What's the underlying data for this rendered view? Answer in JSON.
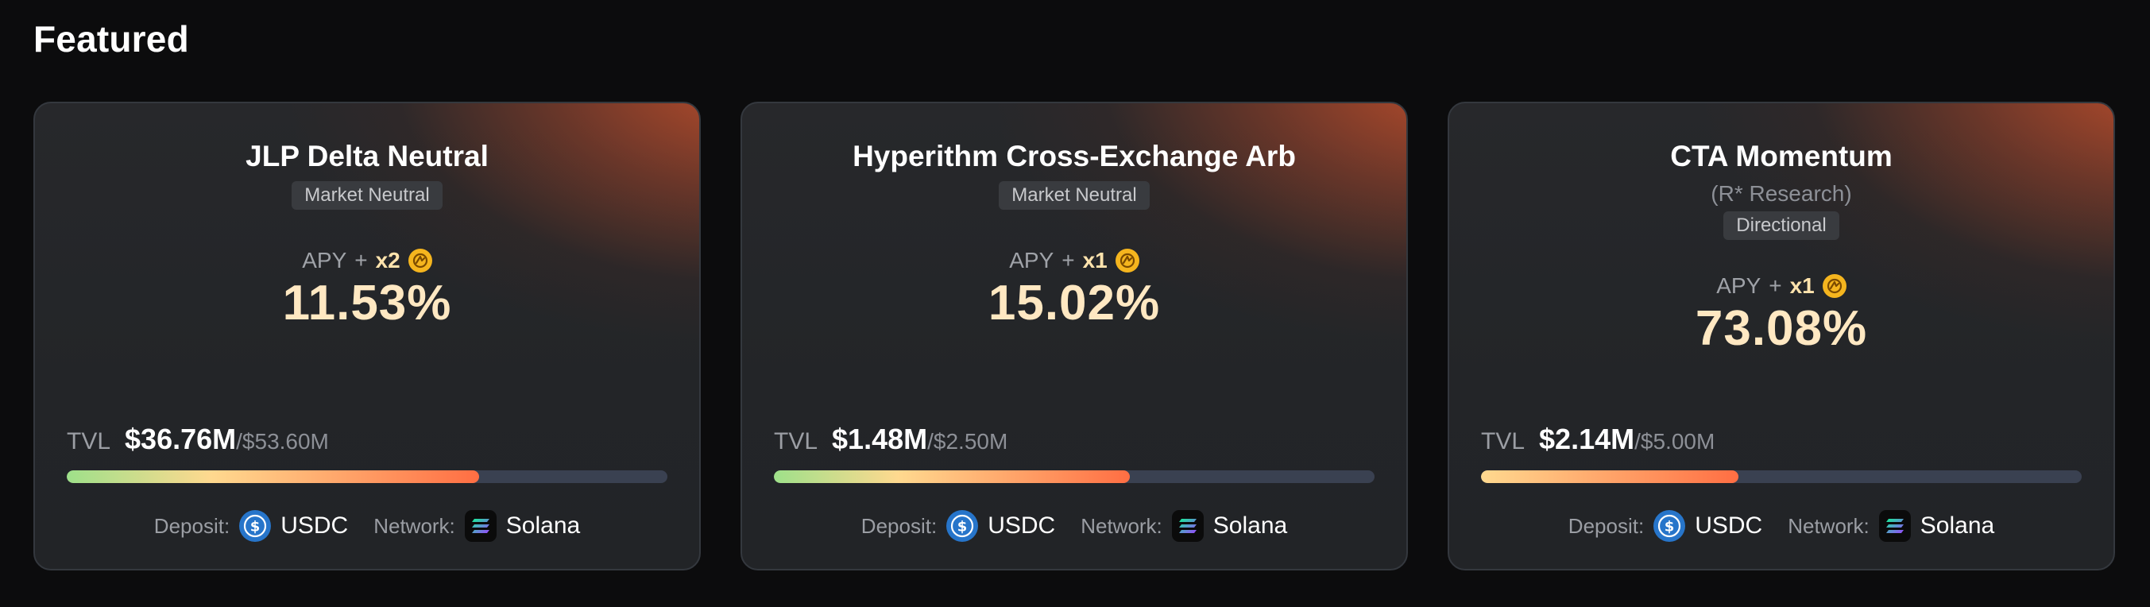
{
  "section": {
    "title": "Featured"
  },
  "labels": {
    "apy": "APY",
    "plus": "+",
    "tvl": "TVL",
    "deposit": "Deposit:",
    "network": "Network:"
  },
  "colors": {
    "background": "#0c0c0d",
    "card_glow": "#c6502c",
    "apy_value": "#ffe8c2",
    "progress_track": "#3a4151",
    "progress_start": "#9ee08a",
    "progress_mid": "#ffd98f",
    "progress_end": "#ff6e43",
    "reward_coin": "#f5b51e",
    "usdc": "#2775ca"
  },
  "cards": [
    {
      "title": "JLP Delta Neutral",
      "subtitle": "",
      "tag": "Market Neutral",
      "multiplier": "x2",
      "reward_icon": "reward-coin-icon",
      "apy": "11.53%",
      "tvl": "$36.76M",
      "tvl_cap": "/$53.60M",
      "fill_fraction": 0.686,
      "deposit": {
        "asset": "USDC",
        "icon": "usdc-icon"
      },
      "network": {
        "name": "Solana",
        "icon": "solana-icon"
      }
    },
    {
      "title": "Hyperithm Cross-Exchange Arb",
      "subtitle": "",
      "tag": "Market Neutral",
      "multiplier": "x1",
      "reward_icon": "reward-coin-icon",
      "apy": "15.02%",
      "tvl": "$1.48M",
      "tvl_cap": "/$2.50M",
      "fill_fraction": 0.592,
      "deposit": {
        "asset": "USDC",
        "icon": "usdc-icon"
      },
      "network": {
        "name": "Solana",
        "icon": "solana-icon"
      }
    },
    {
      "title": "CTA Momentum",
      "subtitle": "(R* Research)",
      "tag": "Directional",
      "multiplier": "x1",
      "reward_icon": "reward-coin-icon",
      "apy": "73.08%",
      "tvl": "$2.14M",
      "tvl_cap": "/$5.00M",
      "fill_fraction": 0.428,
      "deposit": {
        "asset": "USDC",
        "icon": "usdc-icon"
      },
      "network": {
        "name": "Solana",
        "icon": "solana-icon"
      }
    }
  ]
}
